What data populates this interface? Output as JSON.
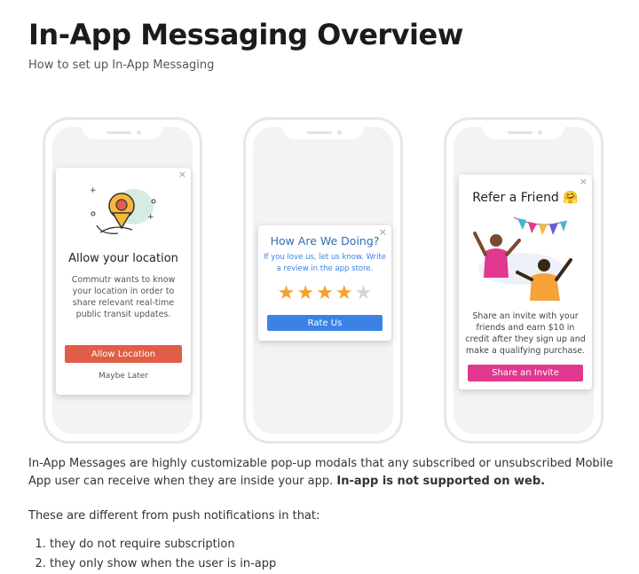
{
  "page": {
    "title": "In-App Messaging Overview",
    "subtitle": "How to set up In-App Messaging"
  },
  "mockups": {
    "location": {
      "close": "×",
      "heading": "Allow your location",
      "body": "Commutr wants to know your location in order to share relevant real-time public transit updates.",
      "primary_button": "Allow Location",
      "secondary_link": "Maybe Later",
      "button_color": "#e25d47"
    },
    "rating": {
      "close": "×",
      "heading": "How Are We Doing?",
      "body": "If you love us, let us know. Write a review in the app store.",
      "rating_value": 4,
      "rating_max": 5,
      "button": "Rate Us",
      "heading_color": "#2e6fae",
      "button_color": "#3b82e4",
      "star_color": "#f4a02c"
    },
    "referral": {
      "close": "×",
      "heading": "Refer a Friend 🤗",
      "body": "Share an invite with your friends and earn $10 in credit after they sign up and make a qualifying purchase.",
      "button": "Share an Invite",
      "button_color": "#e2378f"
    }
  },
  "intro": {
    "text": "In-App Messages are highly customizable pop-up modals that any subscribed or unsubscribed Mobile App user can receive when they are inside your app.",
    "bold": "In-app is not supported on web."
  },
  "difference_text": "These are different from push notifications in that:",
  "differences": [
    "they do not require subscription",
    "they only show when the user is in-app"
  ]
}
